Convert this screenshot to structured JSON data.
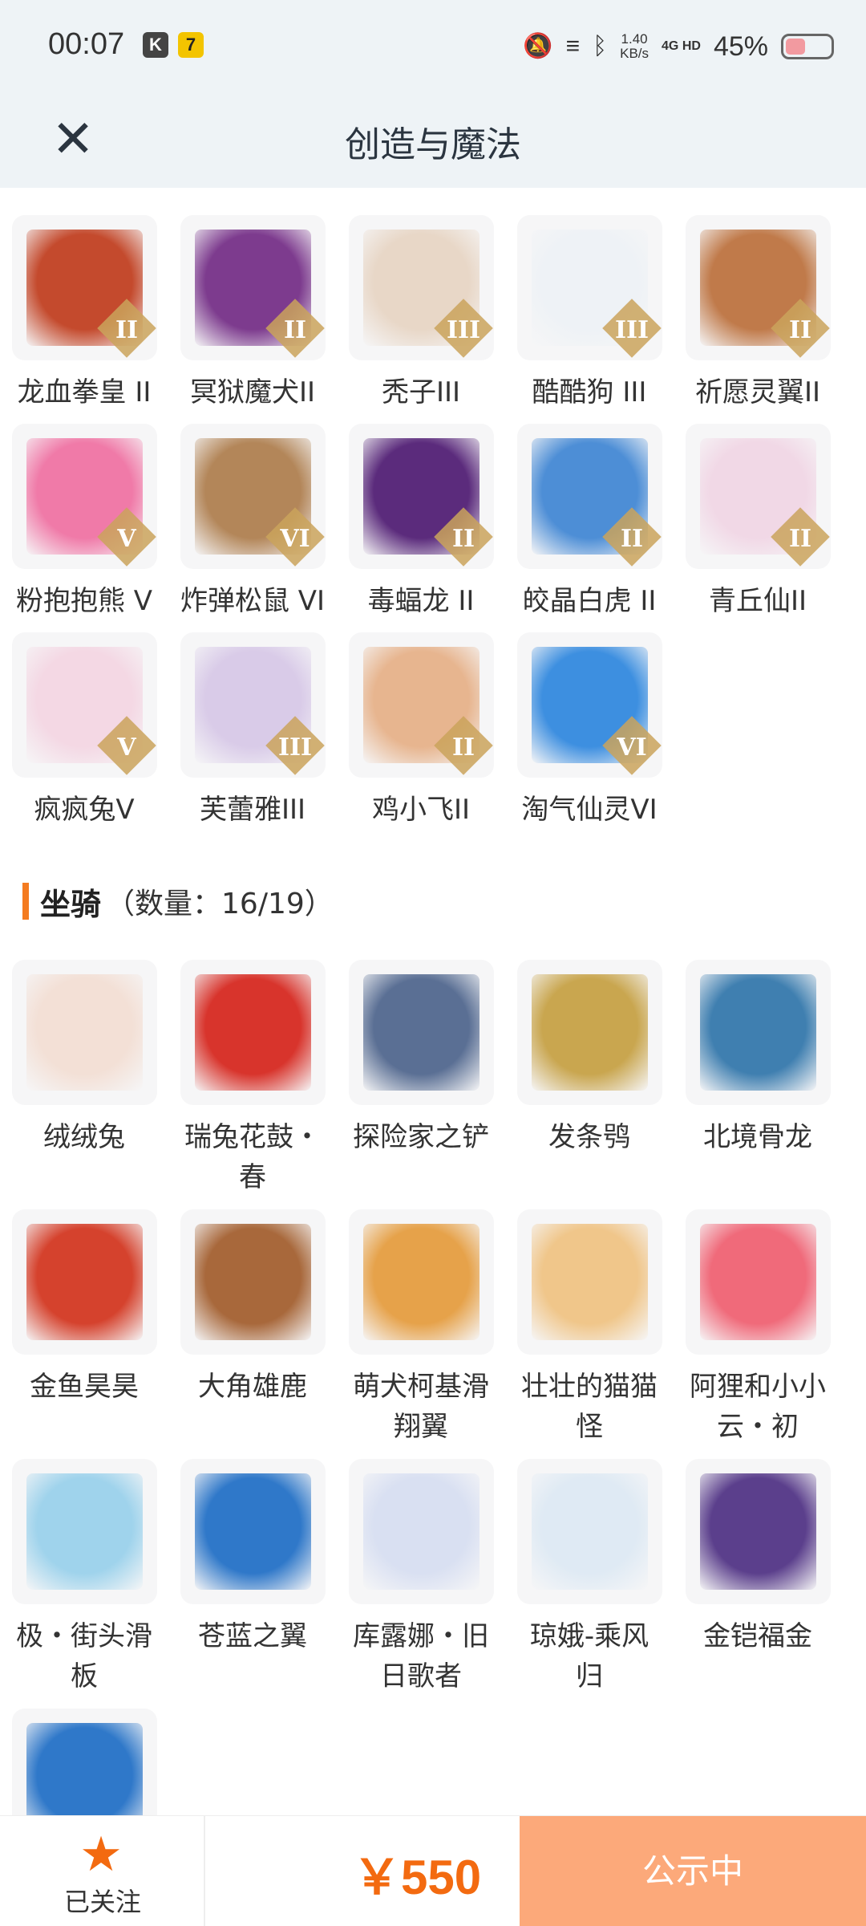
{
  "status_bar": {
    "time": "00:07",
    "app_icon_1": "K",
    "app_icon_2": "7",
    "speed_value": "1.40",
    "speed_unit": "KB/s",
    "network": "4G HD",
    "battery": "45%",
    "battery_level": 0.45
  },
  "header": {
    "title": "创造与魔法"
  },
  "pets": [
    {
      "label": "龙血拳皇 II",
      "tier": "II",
      "color": "#c44a2d"
    },
    {
      "label": "冥狱魔犬II",
      "tier": "II",
      "color": "#7d3b8e"
    },
    {
      "label": "秃子III",
      "tier": "III",
      "color": "#e8d7c7"
    },
    {
      "label": "酷酷狗 III",
      "tier": "III",
      "color": "#eef2f6"
    },
    {
      "label": "祈愿灵翼II",
      "tier": "II",
      "color": "#c07a4a"
    },
    {
      "label": "粉抱抱熊 V",
      "tier": "V",
      "color": "#f07aa8"
    },
    {
      "label": "炸弹松鼠 VI",
      "tier": "VI",
      "color": "#b38659"
    },
    {
      "label": "毒蝠龙 II",
      "tier": "II",
      "color": "#5b2b7c"
    },
    {
      "label": "皎晶白虎 II",
      "tier": "II",
      "color": "#4d8ed6"
    },
    {
      "label": "青丘仙II",
      "tier": "II",
      "color": "#f1d8e6"
    },
    {
      "label": "疯疯兔V",
      "tier": "V",
      "color": "#f4d8e4"
    },
    {
      "label": "芙蕾雅III",
      "tier": "III",
      "color": "#d9cbe8"
    },
    {
      "label": "鸡小飞II",
      "tier": "II",
      "color": "#e7b58f"
    },
    {
      "label": "淘气仙灵VI",
      "tier": "VI",
      "color": "#3d8fe0"
    }
  ],
  "mounts_section": {
    "title": "坐骑",
    "count": "（数量：16/19）"
  },
  "mounts": [
    {
      "label": "绒绒兔",
      "color": "#f3e0d6"
    },
    {
      "label": "瑞兔花鼓・\n春",
      "color": "#d8342c"
    },
    {
      "label": "探险家之铲",
      "color": "#5a6f94"
    },
    {
      "label": "发条鸮",
      "color": "#c9a64f"
    },
    {
      "label": "北境骨龙",
      "color": "#3f7fb0"
    },
    {
      "label": "金鱼昊昊",
      "color": "#d5422d"
    },
    {
      "label": "大角雄鹿",
      "color": "#a8683b"
    },
    {
      "label": "萌犬柯基滑\n翔翼",
      "color": "#e6a24a"
    },
    {
      "label": "壮壮的猫猫\n怪",
      "color": "#f0c68a"
    },
    {
      "label": "阿狸和小小\n云・初",
      "color": "#f06a7a"
    },
    {
      "label": "极・街头滑\n板",
      "color": "#9fd3ec"
    },
    {
      "label": "苍蓝之翼",
      "color": "#2f78c9"
    },
    {
      "label": "库露娜・旧\n日歌者",
      "color": "#d9e0f2"
    },
    {
      "label": "琼娥-乘风\n归",
      "color": "#dfeaf4"
    },
    {
      "label": "金铠福金",
      "color": "#5b3f8c"
    },
    {
      "label": "",
      "color": "#2f78c9"
    }
  ],
  "bottom_bar": {
    "follow_label": "已关注",
    "price": "￥550",
    "publish_label": "公示中"
  }
}
